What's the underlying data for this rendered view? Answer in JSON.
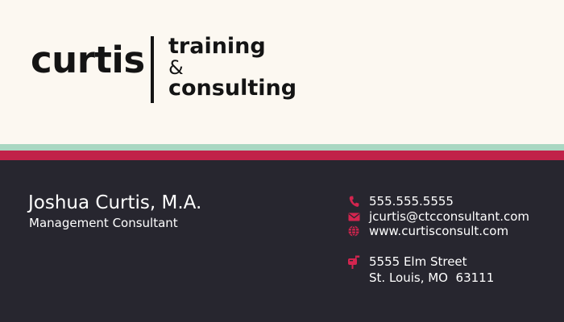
{
  "brand": {
    "name": "curtis",
    "tagline": [
      "training",
      "&",
      "consulting"
    ]
  },
  "person": {
    "name": "Joshua Curtis, M.A.",
    "title": "Management Consultant"
  },
  "contact": {
    "phone": "555.555.5555",
    "email": "jcurtis@ctcconsultant.com",
    "website": "www.curtisconsult.com",
    "address_line1": "5555 Elm Street",
    "address_line2": "St. Louis, MO  63111"
  },
  "icons": {
    "phone": "phone-icon",
    "email": "envelope-icon",
    "website": "globe-icon",
    "address": "mailbox-icon"
  },
  "colors": {
    "background_top": "#fcf8f1",
    "background_bottom": "#27262f",
    "stripe_mint": "#a9d7c2",
    "stripe_red": "#c12249",
    "accent": "#d3254f",
    "text_dark": "#141414",
    "text_light": "#ffffff"
  }
}
